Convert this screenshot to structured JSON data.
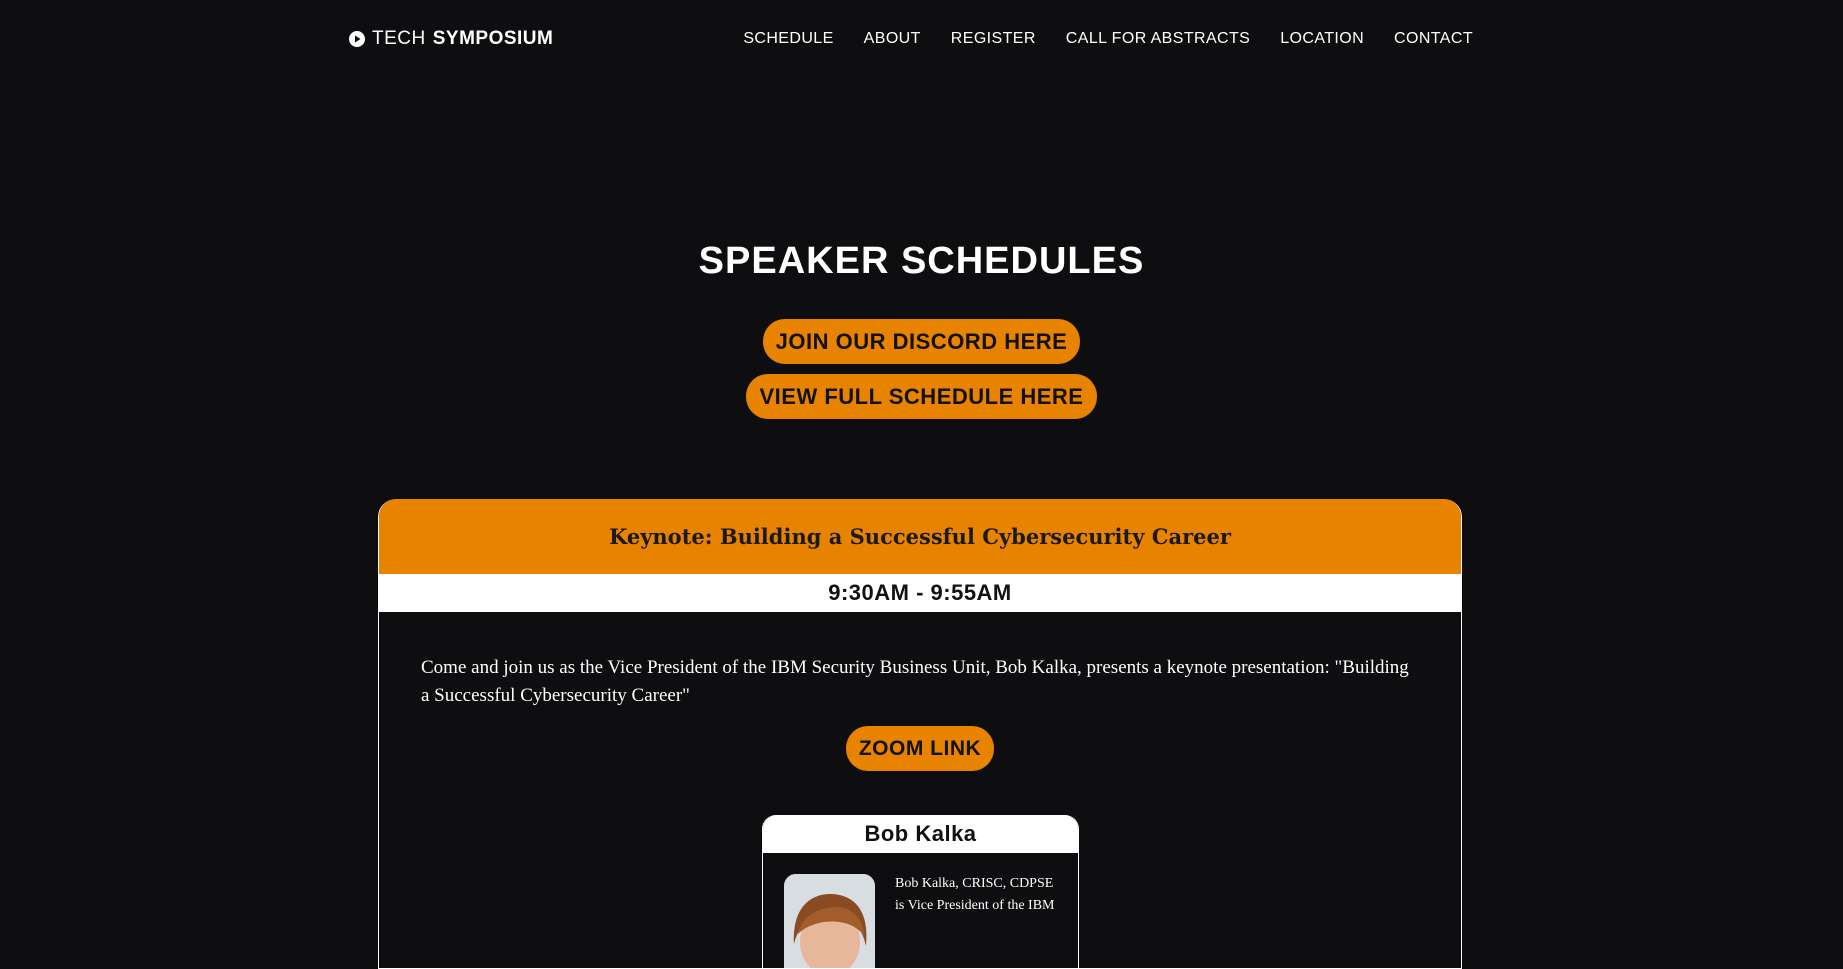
{
  "brand": {
    "light": "TECH",
    "bold": "SYMPOSIUM",
    "icon": "play-circle-icon"
  },
  "nav": {
    "items": [
      {
        "label": "SCHEDULE"
      },
      {
        "label": "ABOUT"
      },
      {
        "label": "REGISTER"
      },
      {
        "label": "CALL FOR ABSTRACTS"
      },
      {
        "label": "LOCATION"
      },
      {
        "label": "CONTACT"
      }
    ]
  },
  "hero": {
    "title": "SPEAKER SCHEDULES",
    "discord_label": "JOIN OUR DISCORD HERE",
    "schedule_label": "VIEW FULL SCHEDULE HERE"
  },
  "session": {
    "title": "Keynote: Building a Successful Cybersecurity Career",
    "time": "9:30AM - 9:55AM",
    "description": "Come and join us as the Vice President of the IBM Security Business Unit, Bob Kalka, presents a keynote presentation: \"Building a Successful Cybersecurity Career\"",
    "zoom_label": "ZOOM LINK",
    "speaker": {
      "name": "Bob Kalka",
      "bio": "Bob Kalka, CRISC, CDPSE is Vice President of the IBM"
    }
  },
  "colors": {
    "background": "#0e0e10",
    "accent": "#e88300",
    "text": "#ffffff"
  }
}
